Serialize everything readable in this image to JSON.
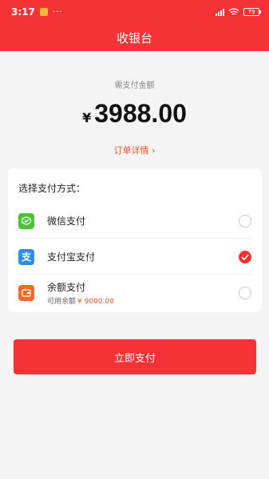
{
  "status": {
    "time": "3:17",
    "more": "···",
    "battery": "79"
  },
  "header": {
    "title": "收银台"
  },
  "amount": {
    "caption": "需支付金额",
    "currency": "¥",
    "value": "3988.00",
    "order_link": "订单详情 ›"
  },
  "payment": {
    "section_title": "选择支付方式：",
    "methods": [
      {
        "label": "微信支付",
        "icon": "wechat-pay-icon",
        "color": "#4cc339",
        "selected": false
      },
      {
        "label": "支付宝支付",
        "icon": "alipay-icon",
        "color": "#2f8fe8",
        "selected": true
      },
      {
        "label": "余额支付",
        "icon": "wallet-icon",
        "color": "#f56a2a",
        "selected": false,
        "sub_label": "可用余额",
        "balance": "¥ 9000.00"
      }
    ]
  },
  "actions": {
    "pay_now": "立即支付"
  },
  "colors": {
    "brand": "#f53336",
    "accent": "#f5552a"
  }
}
